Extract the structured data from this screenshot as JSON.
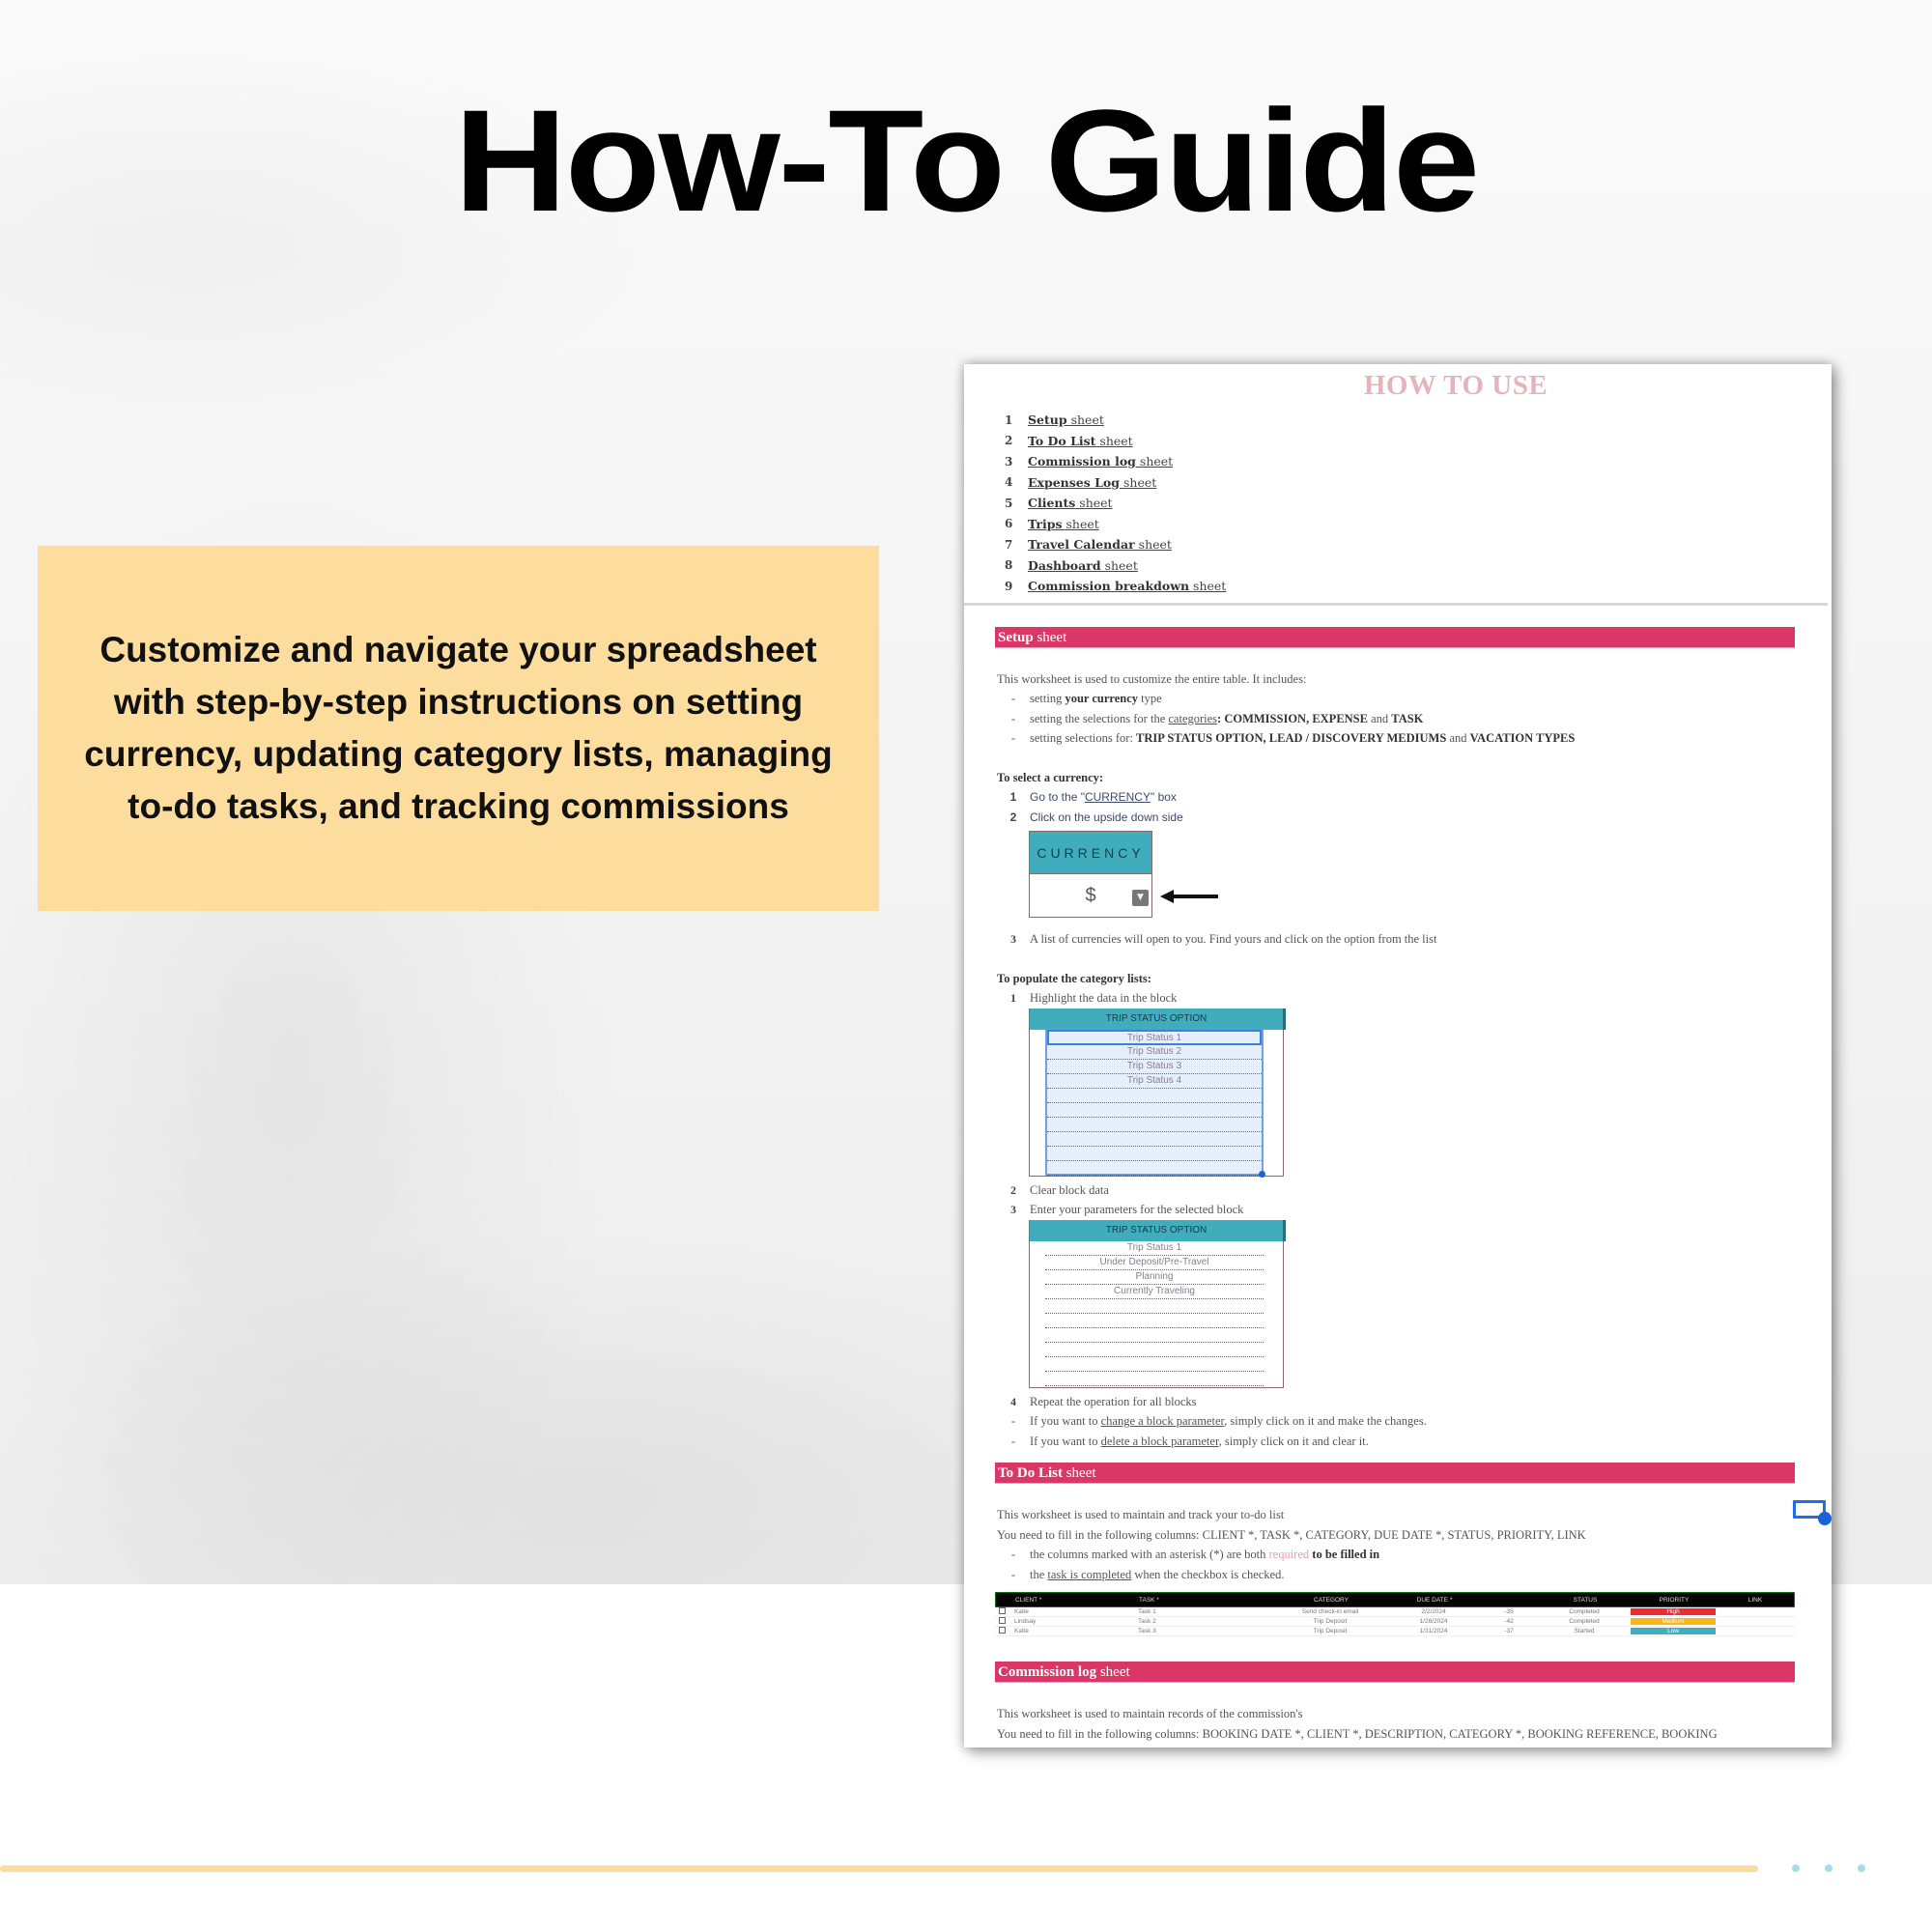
{
  "headline": "How-To Guide",
  "callout": {
    "text": "Customize and navigate your spreadsheet with step-by-step instructions on setting currency, updating category lists, managing to-do tasks, and tracking commissions"
  },
  "doc": {
    "title": "HOW TO USE",
    "toc": [
      {
        "num": "1",
        "name": "Setup",
        "suffix": "sheet"
      },
      {
        "num": "2",
        "name": "To Do List",
        "suffix": "sheet"
      },
      {
        "num": "3",
        "name": "Commission log",
        "suffix": "sheet"
      },
      {
        "num": "4",
        "name": "Expenses Log",
        "suffix": "sheet"
      },
      {
        "num": "5",
        "name": "Clients",
        "suffix": "sheet"
      },
      {
        "num": "6",
        "name": "Trips",
        "suffix": "sheet"
      },
      {
        "num": "7",
        "name": "Travel Calendar",
        "suffix": "sheet"
      },
      {
        "num": "8",
        "name": "Dashboard",
        "suffix": "sheet"
      },
      {
        "num": "9",
        "name": "Commission breakdown",
        "suffix": "sheet"
      }
    ],
    "setup": {
      "heading_bold": "Setup",
      "heading_rest": "sheet",
      "intro": "This worksheet is used to customize the entire table. It includes:",
      "bullets": {
        "b1_pre": "setting ",
        "b1_bold": "your currency",
        "b1_post": " type",
        "b2_pre": "setting the selections for the ",
        "b2_link": "categories",
        "b2_bold": ": COMMISSION, EXPENSE",
        "b2_mid": " and ",
        "b2_bold2": "TASK",
        "b3_pre": "setting selections for: ",
        "b3_bold": "TRIP STATUS OPTION, LEAD / DISCOVERY MEDIUMS",
        "b3_mid": " and ",
        "b3_bold2": "VACATION TYPES"
      },
      "currency_heading": "To select a currency:",
      "currency_steps": {
        "s1_num": "1",
        "s1_pre": "Go to the \"",
        "s1_link": "CURRENCY",
        "s1_post": "\" box",
        "s2_num": "2",
        "s2": "Click on the upside down side",
        "s3_num": "3",
        "s3": "A list of currencies will open to you. Find yours and click on the option from the list"
      },
      "currency_box": {
        "label": "CURRENCY",
        "value": "$"
      },
      "category_heading": "To populate the category lists:",
      "category_steps": {
        "s1_num": "1",
        "s1": "Highlight the data in the block",
        "s2_num": "2",
        "s2": "Clear block data",
        "s3_num": "3",
        "s3": "Enter your parameters for the selected block",
        "s4_num": "4",
        "s4": "Repeat the operation for all blocks"
      },
      "block_before": {
        "header": "TRIP STATUS OPTION",
        "rows": [
          "Trip Status 1",
          "Trip Status 2",
          "Trip Status 3",
          "Trip Status 4",
          "",
          "",
          "",
          "",
          "",
          ""
        ]
      },
      "block_after": {
        "header": "TRIP STATUS OPTION",
        "rows": [
          "Trip Status 1",
          "Under Deposit/Pre-Travel",
          "Planning",
          "Currently Traveling",
          "",
          "",
          "",
          "",
          "",
          ""
        ]
      },
      "notes": {
        "n1_pre": "If you want to ",
        "n1_link": "change a block parameter",
        "n1_post": ", simply click on it and make the changes.",
        "n2_pre": "If you want to ",
        "n2_link": "delete a block  parameter",
        "n2_post": ", simply click on it and clear it."
      }
    },
    "todo": {
      "heading_bold": "To Do List",
      "heading_rest": "sheet",
      "intro": "This worksheet is used to maintain and track your to-do list",
      "columns_line": "You need to fill in the following columns: CLIENT *, TASK *, CATEGORY, DUE DATE *, STATUS, PRIORITY, LINK",
      "b1_pre": "the columns marked with an asterisk (*) are both ",
      "b1_req": "required",
      "b1_bold": " to be filled in",
      "b2_pre": "the ",
      "b2_link": "task is completed",
      "b2_post": " when the checkbox is checked.",
      "table": {
        "headers": [
          "",
          "CLIENT *",
          "TASK *",
          "CATEGORY",
          "DUE DATE *",
          "",
          "STATUS",
          "PRIORITY",
          "LINK"
        ],
        "rows": [
          {
            "client": "Katie",
            "task": "Task 1",
            "category": "Send check-in email",
            "due": "2/2/2024",
            "days": "-35",
            "status": "Completed",
            "priority": "High"
          },
          {
            "client": "Lindsay",
            "task": "Task 2",
            "category": "Trip Deposit",
            "due": "1/26/2024",
            "days": "-42",
            "status": "Completed",
            "priority": "Medium"
          },
          {
            "client": "Katie",
            "task": "Task 3",
            "category": "Trip Deposit",
            "due": "1/31/2024",
            "days": "-37",
            "status": "Started",
            "priority": "Low"
          }
        ]
      }
    },
    "commission": {
      "heading_bold": "Commission log",
      "heading_rest": "sheet",
      "intro": "This worksheet is used to maintain records of the commission's",
      "columns_line": "You need to fill in the following columns: BOOKING DATE *, CLIENT *, DESCRIPTION, CATEGORY *, BOOKING  REFERENCE, BOOKING"
    }
  },
  "colors": {
    "accent_pink": "#db3668",
    "teal": "#40adbd",
    "callout_yellow": "#fddd9e",
    "title_pink": "#e6b4b8",
    "priority_high": "#ee2a32",
    "priority_medium": "#fbb71a",
    "priority_low": "#41adbd"
  }
}
